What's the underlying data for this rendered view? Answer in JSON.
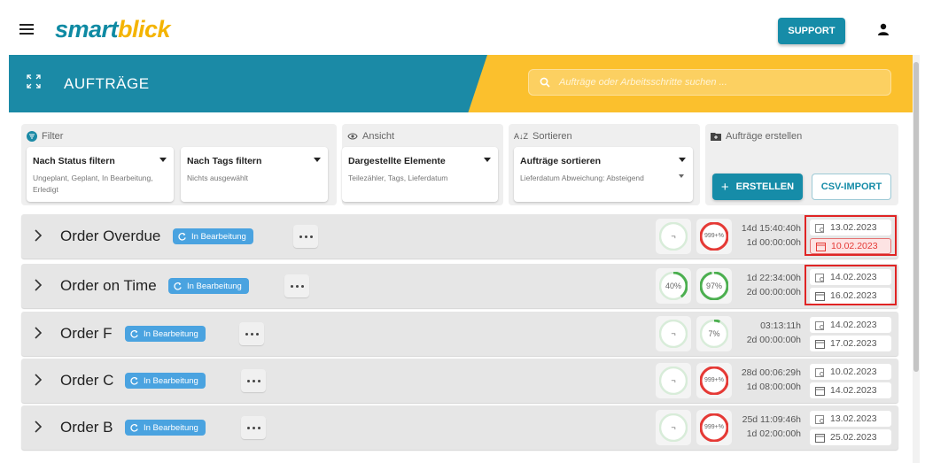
{
  "app": {
    "logo_main": "smart",
    "logo_accent": "blick",
    "support_label": "SUPPORT"
  },
  "banner": {
    "title": "AUFTRÄGE",
    "search_placeholder": "Aufträge oder Arbeitsschritte suchen ...",
    "teal_color": "#1b8aa6",
    "yellow_color": "#fbc02d"
  },
  "filter": {
    "header": "Filter",
    "status": {
      "label": "Nach Status filtern",
      "value": "Ungeplant, Geplant, In Bearbeitung, Erledigt"
    },
    "tags": {
      "label": "Nach Tags filtern",
      "value": "Nichts ausgewählt"
    }
  },
  "ansicht": {
    "header": "Ansicht",
    "label": "Dargestellte Elemente",
    "value": "Teilezähler, Tags, Lieferdatum"
  },
  "sortieren": {
    "header": "Sortieren",
    "label": "Aufträge sortieren",
    "value": "Lieferdatum Abweichung: Absteigend"
  },
  "erstellen": {
    "header": "Aufträge erstellen",
    "create_label": "ERSTELLEN",
    "csv_label": "CSV-IMPORT"
  },
  "orders": [
    {
      "name": "Order Overdue",
      "status": "In Bearbeitung",
      "gauge1": "¬",
      "gauge2": "999+%",
      "time1": "14d 15:40:40h",
      "time2": "1d 00:00:00h",
      "date1": "13.02.2023",
      "date2": "10.02.2023",
      "date2_late": true,
      "highlighted": true
    },
    {
      "name": "Order on Time",
      "status": "In Bearbeitung",
      "gauge1": "40%",
      "gauge2": "97%",
      "time1": "1d 22:34:00h",
      "time2": "2d 00:00:00h",
      "date1": "14.02.2023",
      "date2": "16.02.2023",
      "date2_late": false,
      "highlighted": true
    },
    {
      "name": "Order F",
      "status": "In Bearbeitung",
      "gauge1": "¬",
      "gauge2": "7%",
      "time1": "03:13:11h",
      "time2": "2d 00:00:00h",
      "date1": "14.02.2023",
      "date2": "17.02.2023",
      "date2_late": false,
      "highlighted": false
    },
    {
      "name": "Order C",
      "status": "In Bearbeitung",
      "gauge1": "¬",
      "gauge2": "999+%",
      "time1": "28d 00:06:29h",
      "time2": "1d 08:00:00h",
      "date1": "10.02.2023",
      "date2": "14.02.2023",
      "date2_late": false,
      "highlighted": false
    },
    {
      "name": "Order B",
      "status": "In Bearbeitung",
      "gauge1": "¬",
      "gauge2": "999+%",
      "time1": "25d 11:09:46h",
      "time2": "1d 02:00:00h",
      "date1": "13.02.2023",
      "date2": "25.02.2023",
      "date2_late": false,
      "highlighted": false
    }
  ]
}
